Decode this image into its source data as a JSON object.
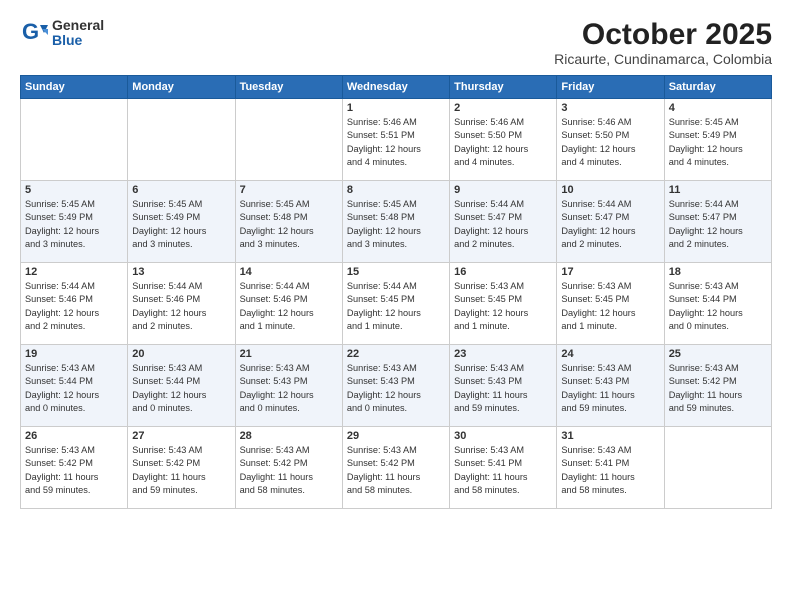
{
  "header": {
    "logo_general": "General",
    "logo_blue": "Blue",
    "month_title": "October 2025",
    "subtitle": "Ricaurte, Cundinamarca, Colombia"
  },
  "days_of_week": [
    "Sunday",
    "Monday",
    "Tuesday",
    "Wednesday",
    "Thursday",
    "Friday",
    "Saturday"
  ],
  "weeks": [
    [
      {
        "day": "",
        "info": ""
      },
      {
        "day": "",
        "info": ""
      },
      {
        "day": "",
        "info": ""
      },
      {
        "day": "1",
        "info": "Sunrise: 5:46 AM\nSunset: 5:51 PM\nDaylight: 12 hours\nand 4 minutes."
      },
      {
        "day": "2",
        "info": "Sunrise: 5:46 AM\nSunset: 5:50 PM\nDaylight: 12 hours\nand 4 minutes."
      },
      {
        "day": "3",
        "info": "Sunrise: 5:46 AM\nSunset: 5:50 PM\nDaylight: 12 hours\nand 4 minutes."
      },
      {
        "day": "4",
        "info": "Sunrise: 5:45 AM\nSunset: 5:49 PM\nDaylight: 12 hours\nand 4 minutes."
      }
    ],
    [
      {
        "day": "5",
        "info": "Sunrise: 5:45 AM\nSunset: 5:49 PM\nDaylight: 12 hours\nand 3 minutes."
      },
      {
        "day": "6",
        "info": "Sunrise: 5:45 AM\nSunset: 5:49 PM\nDaylight: 12 hours\nand 3 minutes."
      },
      {
        "day": "7",
        "info": "Sunrise: 5:45 AM\nSunset: 5:48 PM\nDaylight: 12 hours\nand 3 minutes."
      },
      {
        "day": "8",
        "info": "Sunrise: 5:45 AM\nSunset: 5:48 PM\nDaylight: 12 hours\nand 3 minutes."
      },
      {
        "day": "9",
        "info": "Sunrise: 5:44 AM\nSunset: 5:47 PM\nDaylight: 12 hours\nand 2 minutes."
      },
      {
        "day": "10",
        "info": "Sunrise: 5:44 AM\nSunset: 5:47 PM\nDaylight: 12 hours\nand 2 minutes."
      },
      {
        "day": "11",
        "info": "Sunrise: 5:44 AM\nSunset: 5:47 PM\nDaylight: 12 hours\nand 2 minutes."
      }
    ],
    [
      {
        "day": "12",
        "info": "Sunrise: 5:44 AM\nSunset: 5:46 PM\nDaylight: 12 hours\nand 2 minutes."
      },
      {
        "day": "13",
        "info": "Sunrise: 5:44 AM\nSunset: 5:46 PM\nDaylight: 12 hours\nand 2 minutes."
      },
      {
        "day": "14",
        "info": "Sunrise: 5:44 AM\nSunset: 5:46 PM\nDaylight: 12 hours\nand 1 minute."
      },
      {
        "day": "15",
        "info": "Sunrise: 5:44 AM\nSunset: 5:45 PM\nDaylight: 12 hours\nand 1 minute."
      },
      {
        "day": "16",
        "info": "Sunrise: 5:43 AM\nSunset: 5:45 PM\nDaylight: 12 hours\nand 1 minute."
      },
      {
        "day": "17",
        "info": "Sunrise: 5:43 AM\nSunset: 5:45 PM\nDaylight: 12 hours\nand 1 minute."
      },
      {
        "day": "18",
        "info": "Sunrise: 5:43 AM\nSunset: 5:44 PM\nDaylight: 12 hours\nand 0 minutes."
      }
    ],
    [
      {
        "day": "19",
        "info": "Sunrise: 5:43 AM\nSunset: 5:44 PM\nDaylight: 12 hours\nand 0 minutes."
      },
      {
        "day": "20",
        "info": "Sunrise: 5:43 AM\nSunset: 5:44 PM\nDaylight: 12 hours\nand 0 minutes."
      },
      {
        "day": "21",
        "info": "Sunrise: 5:43 AM\nSunset: 5:43 PM\nDaylight: 12 hours\nand 0 minutes."
      },
      {
        "day": "22",
        "info": "Sunrise: 5:43 AM\nSunset: 5:43 PM\nDaylight: 12 hours\nand 0 minutes."
      },
      {
        "day": "23",
        "info": "Sunrise: 5:43 AM\nSunset: 5:43 PM\nDaylight: 11 hours\nand 59 minutes."
      },
      {
        "day": "24",
        "info": "Sunrise: 5:43 AM\nSunset: 5:43 PM\nDaylight: 11 hours\nand 59 minutes."
      },
      {
        "day": "25",
        "info": "Sunrise: 5:43 AM\nSunset: 5:42 PM\nDaylight: 11 hours\nand 59 minutes."
      }
    ],
    [
      {
        "day": "26",
        "info": "Sunrise: 5:43 AM\nSunset: 5:42 PM\nDaylight: 11 hours\nand 59 minutes."
      },
      {
        "day": "27",
        "info": "Sunrise: 5:43 AM\nSunset: 5:42 PM\nDaylight: 11 hours\nand 59 minutes."
      },
      {
        "day": "28",
        "info": "Sunrise: 5:43 AM\nSunset: 5:42 PM\nDaylight: 11 hours\nand 58 minutes."
      },
      {
        "day": "29",
        "info": "Sunrise: 5:43 AM\nSunset: 5:42 PM\nDaylight: 11 hours\nand 58 minutes."
      },
      {
        "day": "30",
        "info": "Sunrise: 5:43 AM\nSunset: 5:41 PM\nDaylight: 11 hours\nand 58 minutes."
      },
      {
        "day": "31",
        "info": "Sunrise: 5:43 AM\nSunset: 5:41 PM\nDaylight: 11 hours\nand 58 minutes."
      },
      {
        "day": "",
        "info": ""
      }
    ]
  ]
}
